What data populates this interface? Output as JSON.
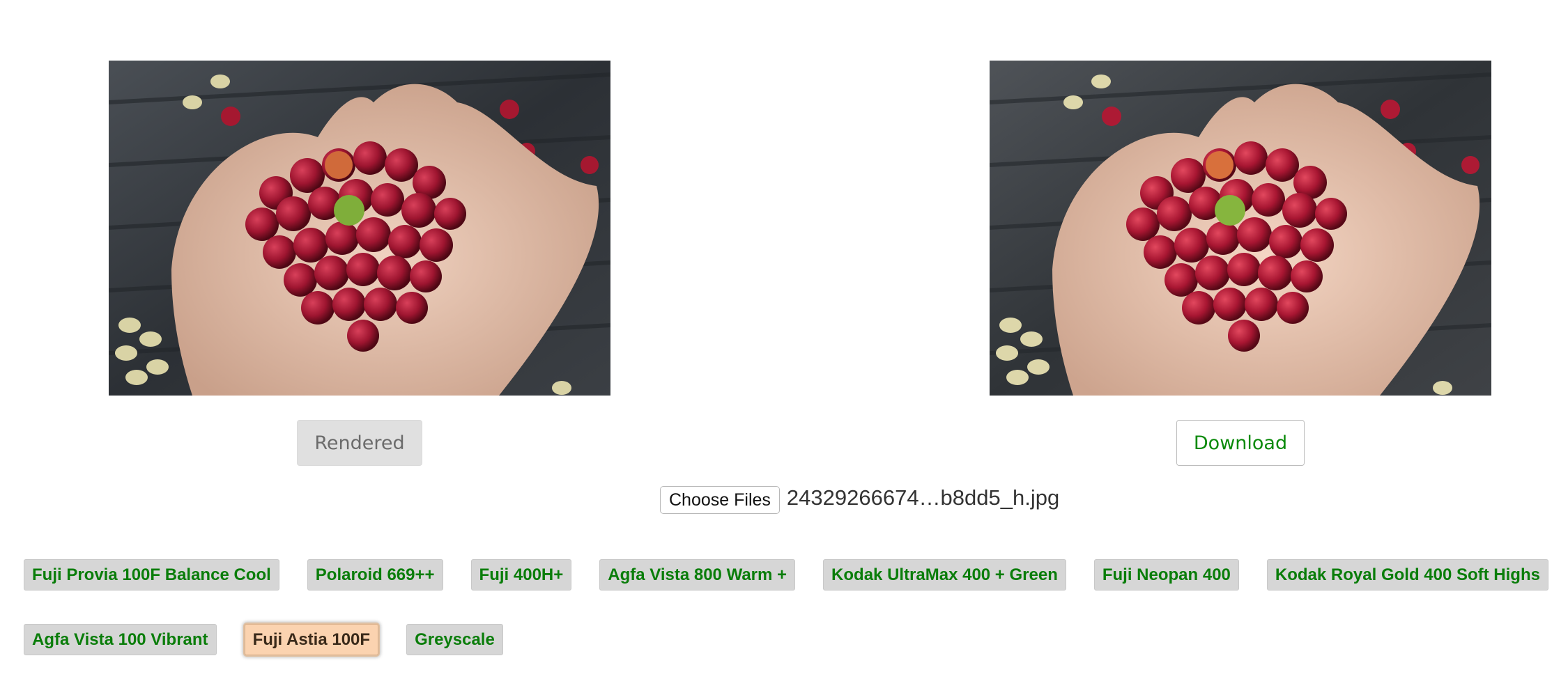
{
  "images": {
    "left_icon": "photo-hands-coffee-cherries",
    "right_icon": "photo-hands-coffee-cherries"
  },
  "actions": {
    "rendered_label": "Rendered",
    "download_label": "Download"
  },
  "file_input": {
    "button_label": "Choose Files",
    "file_name": "24329266674…b8dd5_h.jpg"
  },
  "filters": {
    "row1": [
      "Fuji Provia 100F Balance Cool",
      "Polaroid 669++",
      "Fuji 400H+",
      "Agfa Vista 800 Warm +",
      "Kodak UltraMax 400 + Green",
      "Fuji Neopan 400",
      "Kodak Royal Gold 400 Soft Highs"
    ],
    "row2": [
      "Agfa Vista 100 Vibrant",
      "Fuji Astia 100F",
      "Greyscale"
    ],
    "active": "Fuji Astia 100F"
  },
  "colors": {
    "accent_green": "#0a8a0a",
    "filter_bg": "#d6d6d6",
    "active_filter_bg": "#fbd3b0"
  }
}
